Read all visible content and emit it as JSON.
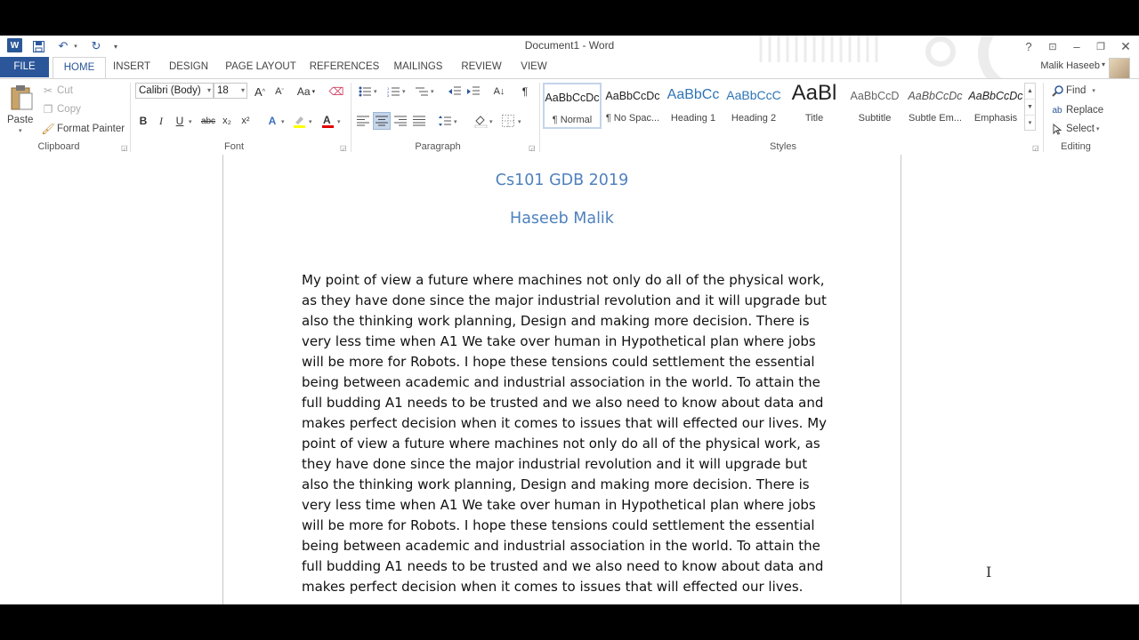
{
  "window": {
    "title": "Document1 - Word"
  },
  "qat": {
    "word_icon": "W",
    "save": "save-icon",
    "undo": "undo-icon",
    "redo": "redo-icon"
  },
  "titlebar_buttons": {
    "help": "?",
    "options": "ribbon-display-icon",
    "minimize": "minimize-icon",
    "restore": "restore-icon",
    "close": "close-icon"
  },
  "tabs": [
    {
      "label": "FILE"
    },
    {
      "label": "HOME"
    },
    {
      "label": "INSERT"
    },
    {
      "label": "DESIGN"
    },
    {
      "label": "PAGE LAYOUT"
    },
    {
      "label": "REFERENCES"
    },
    {
      "label": "MAILINGS"
    },
    {
      "label": "REVIEW"
    },
    {
      "label": "VIEW"
    }
  ],
  "user": {
    "name": "Malik Haseeb"
  },
  "clipboard": {
    "paste": "Paste",
    "cut": "Cut",
    "copy": "Copy",
    "format_painter": "Format Painter",
    "label": "Clipboard"
  },
  "font": {
    "name": "Calibri (Body)",
    "size": "18",
    "label": "Font",
    "bold": "B",
    "italic": "I",
    "underline": "U",
    "strike": "abc",
    "sub": "x₂",
    "sup": "x²",
    "grow": "A",
    "shrink": "A",
    "case": "Aa"
  },
  "paragraph": {
    "label": "Paragraph",
    "pilcrow": "¶"
  },
  "styles": {
    "label": "Styles",
    "items": [
      {
        "sample": "AaBbCcDc",
        "name": "¶ Normal"
      },
      {
        "sample": "AaBbCcDc",
        "name": "¶ No Spac..."
      },
      {
        "sample": "AaBbCc",
        "name": "Heading 1"
      },
      {
        "sample": "AaBbCcC",
        "name": "Heading 2"
      },
      {
        "sample": "AaBl",
        "name": "Title"
      },
      {
        "sample": "AaBbCcD",
        "name": "Subtitle"
      },
      {
        "sample": "AaBbCcDc",
        "name": "Subtle Em..."
      },
      {
        "sample": "AaBbCcDc",
        "name": "Emphasis"
      }
    ]
  },
  "editing": {
    "find": "Find",
    "replace": "Replace",
    "select": "Select",
    "label": "Editing"
  },
  "document": {
    "heading1": "Cs101 GDB 2019",
    "heading2": "Haseeb Malik",
    "body": "My point of view a future where machines not only do all of the physical work, as they have done since the major industrial revolution and it will upgrade but also the thinking work planning, Design and making more decision. There is very less time when A1 We take over human in Hypothetical plan where jobs will be more for Robots. I hope these tensions could settlement the essential being between academic and industrial association in the world. To attain the full budding A1 needs to be trusted and we also need to know about data and makes perfect decision when it comes to issues that will effected our lives. My point of view a future where machines not only do all of the physical work, as they have done since the major industrial revolution and it will upgrade but also the thinking work planning, Design and making more decision. There is very less time when A1 We take over human in Hypothetical plan where jobs will be more for Robots. I hope these tensions could settlement the essential being between academic and industrial association in the world. To attain the full budding A1 needs to be trusted and we also need to know about data and makes perfect decision when it comes to issues that will effected our lives."
  },
  "colors": {
    "file_tab": "#2b579a",
    "heading": "#4f81bd",
    "highlight": "#ffff00",
    "font_color": "#e00000"
  }
}
